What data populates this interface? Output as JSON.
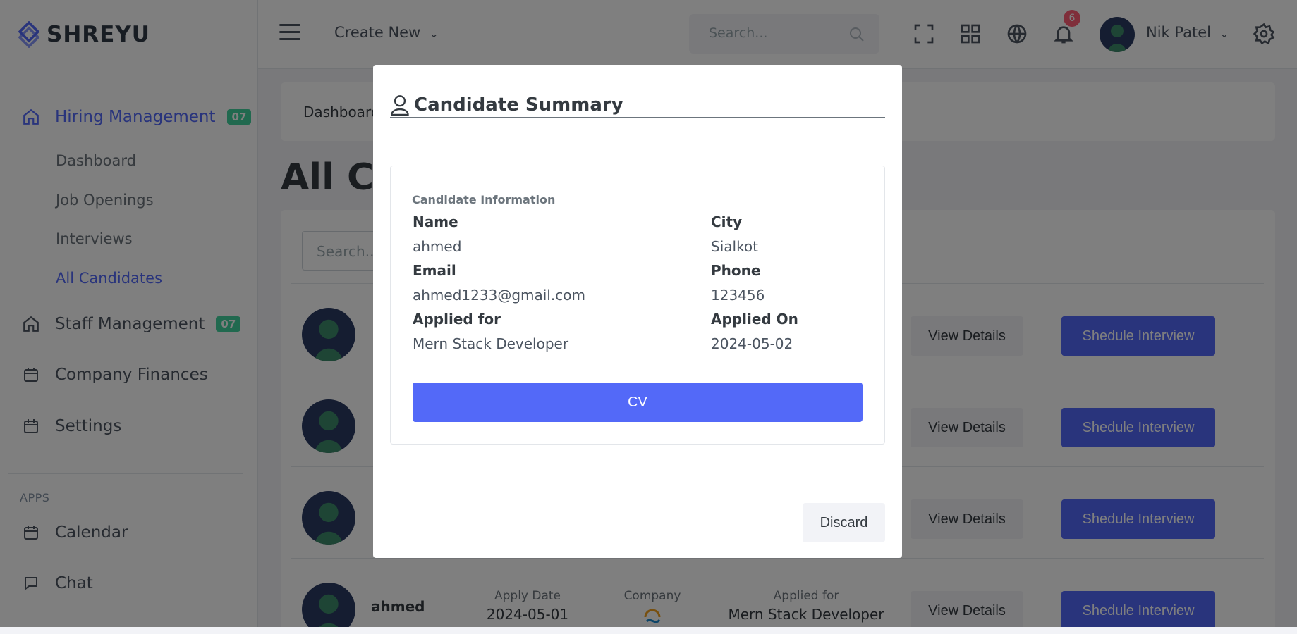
{
  "app": {
    "logo_text": "SHREYU"
  },
  "sidebar": {
    "main_items": [
      {
        "label": "Hiring Management",
        "badge": "07"
      },
      {
        "label": "Staff Management",
        "badge": "07"
      },
      {
        "label": "Company Finances"
      },
      {
        "label": "Settings"
      }
    ],
    "sub_items": [
      {
        "label": "Dashboard"
      },
      {
        "label": "Job Openings"
      },
      {
        "label": "Interviews"
      },
      {
        "label": "All Candidates"
      }
    ],
    "apps_label": "APPS",
    "apps": [
      {
        "label": "Calendar"
      },
      {
        "label": "Chat"
      }
    ]
  },
  "topbar": {
    "create_new": "Create New",
    "search_placeholder": "Search...",
    "notification_count": "6",
    "user_name": "Nik Patel"
  },
  "main": {
    "breadcrumb": "Dashboard",
    "page_title": "All Ca",
    "search_placeholder": "Search..",
    "row_buttons": {
      "view": "View Details",
      "schedule": "Shedule Interview"
    },
    "last_row": {
      "name": "ahmed",
      "apply_date_label": "Apply Date",
      "apply_date": "2024-05-01",
      "company_label": "Company",
      "applied_for_label": "Applied for",
      "applied_for": "Mern Stack Developer"
    }
  },
  "modal": {
    "title": "Candidate Summary",
    "section_heading": "Candidate Information",
    "fields": {
      "name_label": "Name",
      "name": "ahmed",
      "city_label": "City",
      "city": "Sialkot",
      "email_label": "Email",
      "email": "ahmed1233@gmail.com",
      "phone_label": "Phone",
      "phone": "123456",
      "applied_for_label": "Applied for",
      "applied_for": "Mern Stack Developer",
      "applied_on_label": "Applied On",
      "applied_on": "2024-05-02"
    },
    "cv_button": "CV",
    "discard_button": "Discard"
  },
  "colors": {
    "accent": "#5369f8",
    "success": "#43d39e",
    "danger": "#ff5c75"
  }
}
